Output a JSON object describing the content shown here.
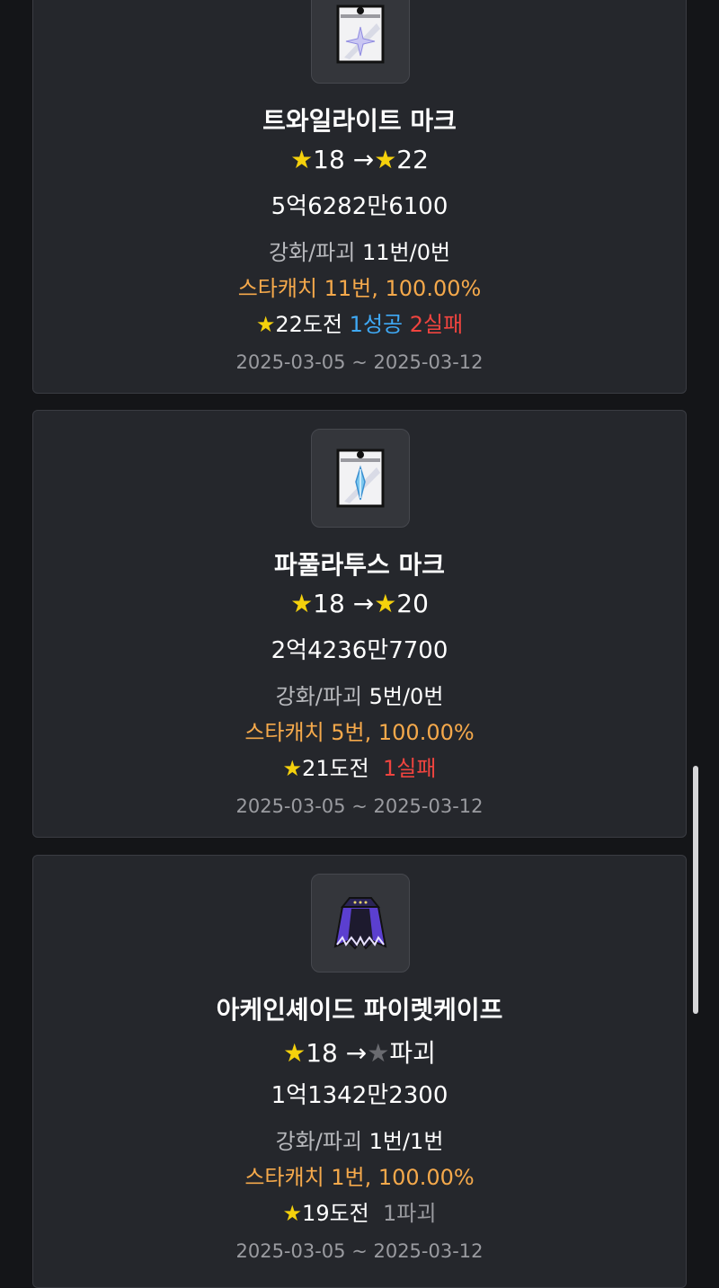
{
  "items": [
    {
      "name": "트와일라이트 마크",
      "icon": "twilight-mark-icon",
      "from_star_glyph": "★",
      "from_star": "18",
      "arrow": "→",
      "to_star_glyph": "★",
      "to_star": "22",
      "cost": "5억6282만6100",
      "enhance_label": "강화/파괴",
      "enhance_value": "11번/0번",
      "starcatch": "스타캐치 11번, 100.00%",
      "challenge_glyph": "★",
      "challenge": "22도전",
      "success": "1성공",
      "fail": "2실패",
      "date": "2025-03-05 ~ 2025-03-12"
    },
    {
      "name": "파풀라투스 마크",
      "icon": "papulatus-mark-icon",
      "from_star_glyph": "★",
      "from_star": "18",
      "arrow": "→",
      "to_star_glyph": "★",
      "to_star": "20",
      "cost": "2억4236만7700",
      "enhance_label": "강화/파괴",
      "enhance_value": "5번/0번",
      "starcatch": "스타캐치 5번, 100.00%",
      "challenge_glyph": "★",
      "challenge": "21도전",
      "fail": "1실패",
      "date": "2025-03-05 ~ 2025-03-12"
    },
    {
      "name": "아케인셰이드 파이렛케이프",
      "icon": "arcane-cape-icon",
      "from_star_glyph": "★",
      "from_star": "18",
      "arrow": "→",
      "to_star_glyph": "★",
      "to_star": "파괴",
      "cost": "1억1342만2300",
      "enhance_label": "강화/파괴",
      "enhance_value": "1번/1번",
      "starcatch": "스타캐치 1번, 100.00%",
      "challenge_glyph": "★",
      "challenge": "19도전",
      "destroy": "1파괴",
      "date": "2025-03-05 ~ 2025-03-12"
    }
  ],
  "colors": {
    "background": "#141518",
    "card": "#25272c",
    "star_gold": "#f5d10c",
    "star_gray": "#6a6b70",
    "starcatch_orange": "#f5a94b",
    "success_blue": "#3fa9f5",
    "fail_red": "#f0443f"
  }
}
